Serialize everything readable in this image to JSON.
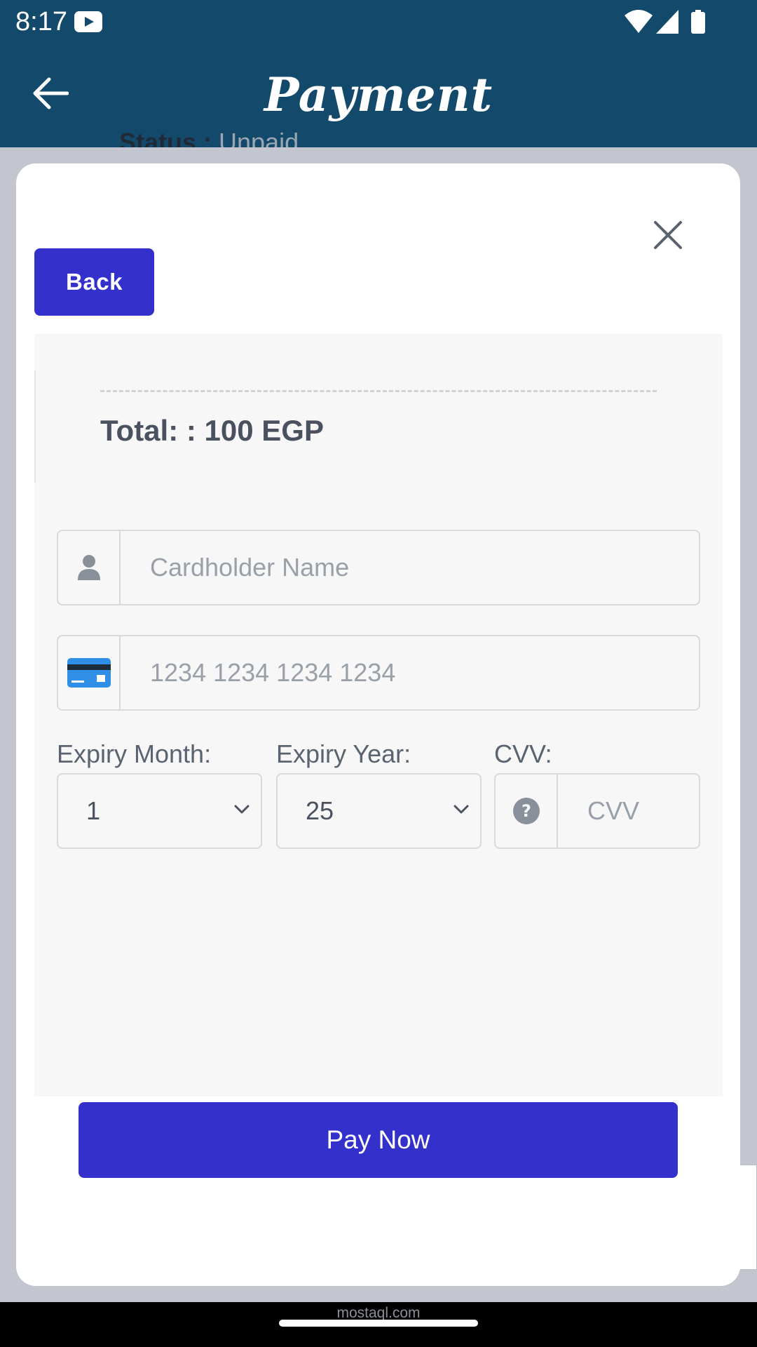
{
  "status_bar": {
    "time": "8:17",
    "icons": [
      "youtube-icon",
      "wifi-icon",
      "signal-icon",
      "battery-icon"
    ]
  },
  "app_bar": {
    "title": "Payment",
    "back_icon": "arrow-left-icon"
  },
  "background": {
    "status_label": "Status : ",
    "status_value": "Unpaid"
  },
  "modal": {
    "close_icon": "close-icon",
    "back_label": "Back",
    "total_text": "Total: : 100 EGP",
    "cardholder": {
      "placeholder": "Cardholder Name",
      "icon": "user-icon"
    },
    "card_number": {
      "placeholder": "1234 1234 1234 1234",
      "icon": "credit-card-icon"
    },
    "expiry_month": {
      "label": "Expiry Month:",
      "value": "1"
    },
    "expiry_year": {
      "label": "Expiry Year:",
      "value": "25"
    },
    "cvv": {
      "label": "CVV:",
      "placeholder": "CVV",
      "icon": "help-circle-icon"
    },
    "pay_label": "Pay Now"
  },
  "footer": {
    "watermark": "mostaql.com"
  },
  "colors": {
    "app_bar": "#134a6c",
    "primary_button": "#3430cc",
    "card_icon": "#2f8fe6"
  }
}
